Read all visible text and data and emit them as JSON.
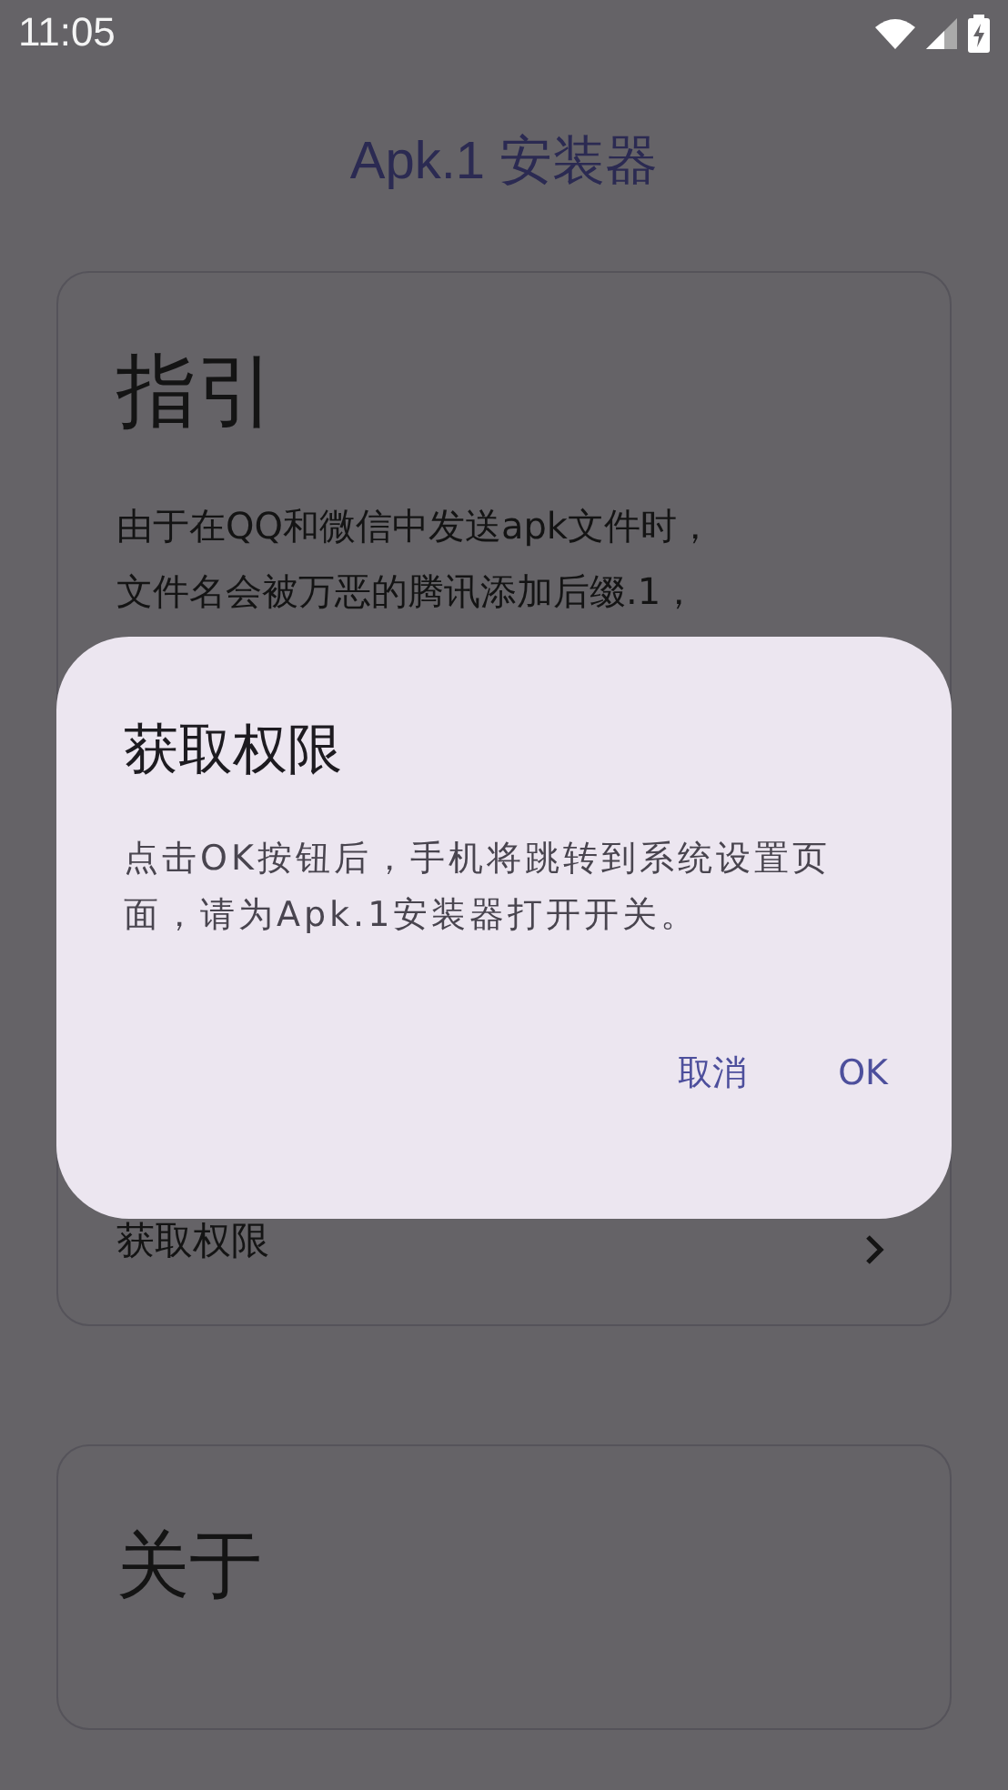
{
  "status_bar": {
    "time": "11:05"
  },
  "app_bar": {
    "title": "Apk.1 安装器"
  },
  "guide_card": {
    "title": "指引",
    "lines": [
      "由于在QQ和微信中发送apk文件时，",
      "文件名会被万恶的腾讯添加后缀.1，"
    ]
  },
  "permission_card": {
    "label": "获取权限"
  },
  "about_card": {
    "title": "关于"
  },
  "dialog": {
    "title": "获取权限",
    "message": "点击OK按钮后，手机将跳转到系统设置页面，请为Apk.1安装器打开开关。",
    "buttons": [
      "取消",
      "OK"
    ]
  }
}
